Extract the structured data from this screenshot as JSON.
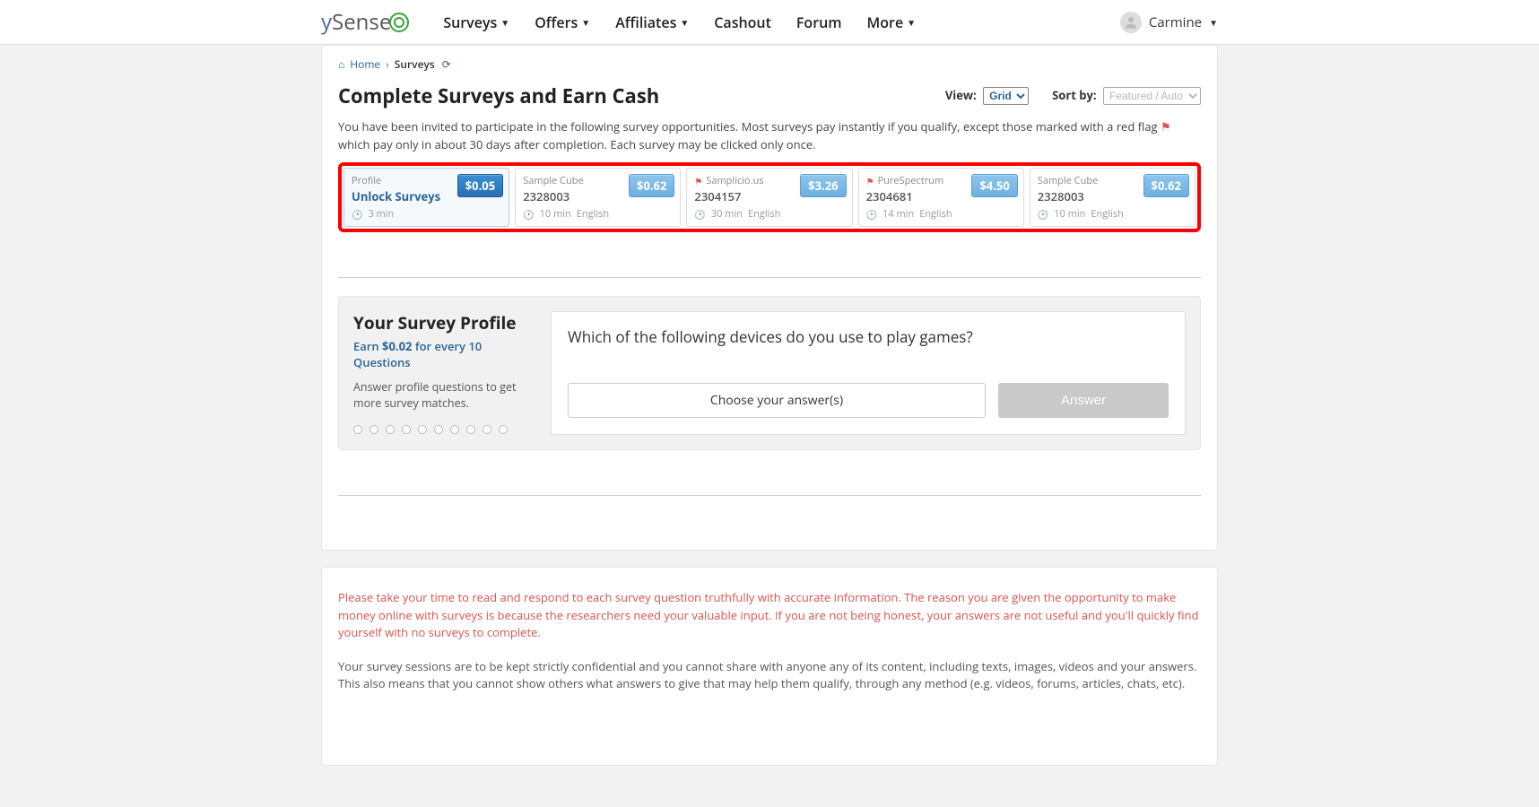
{
  "nav": {
    "items": [
      "Surveys",
      "Offers",
      "Affiliates",
      "Cashout",
      "Forum",
      "More"
    ],
    "has_dropdown": [
      true,
      true,
      true,
      false,
      false,
      true
    ]
  },
  "user": {
    "name": "Carmine"
  },
  "breadcrumb": {
    "home": "Home",
    "current": "Surveys"
  },
  "page_title": "Complete Surveys and Earn Cash",
  "view": {
    "label": "View:",
    "selected": "Grid",
    "options": [
      "Grid"
    ]
  },
  "sort": {
    "label": "Sort by:",
    "selected": "Featured / Auto",
    "options": [
      "Featured / Auto"
    ]
  },
  "intro_a": "You have been invited to participate in the following survey opportunities. Most surveys pay instantly if you qualify, except those marked with a red flag ",
  "intro_b": " which pay only in about 30 days after completion. Each survey may be clicked only once.",
  "surveys": [
    {
      "provider": "Profile",
      "flag": false,
      "title": "Unlock Surveys",
      "time": "3 min",
      "lang": "",
      "price": "$0.05",
      "active": true
    },
    {
      "provider": "Sample Cube",
      "flag": false,
      "title": "2328003",
      "time": "10 min",
      "lang": "English",
      "price": "$0.62",
      "active": false
    },
    {
      "provider": "Samplicio.us",
      "flag": true,
      "title": "2304157",
      "time": "30 min",
      "lang": "English",
      "price": "$3.26",
      "active": false
    },
    {
      "provider": "PureSpectrum",
      "flag": true,
      "title": "2304681",
      "time": "14 min",
      "lang": "English",
      "price": "$4.50",
      "active": false
    },
    {
      "provider": "Sample Cube",
      "flag": false,
      "title": "2328003",
      "time": "10 min",
      "lang": "English",
      "price": "$0.62",
      "active": false
    }
  ],
  "profile": {
    "heading": "Your Survey Profile",
    "earn_prefix": "Earn ",
    "earn_amount": "$0.02",
    "earn_suffix": " for every 10 Questions",
    "desc": "Answer profile questions to get more survey matches.",
    "dots": 10,
    "question": "Which of the following devices do you use to play games?",
    "choose": "Choose your answer(s)",
    "answer_btn": "Answer"
  },
  "notice": {
    "red": "Please take your time to read and respond to each survey question truthfully with accurate information. The reason you are given the opportunity to make money online with surveys is because the researchers need your valuable input. If you are not being honest, your answers are not useful and you'll quickly find yourself with no surveys to complete.",
    "gray": "Your survey sessions are to be kept strictly confidential and you cannot share with anyone any of its content, including texts, images, videos and your answers. This also means that you cannot show others what answers to give that may help them qualify, through any method (e.g. videos, forums, articles, chats, etc)."
  }
}
